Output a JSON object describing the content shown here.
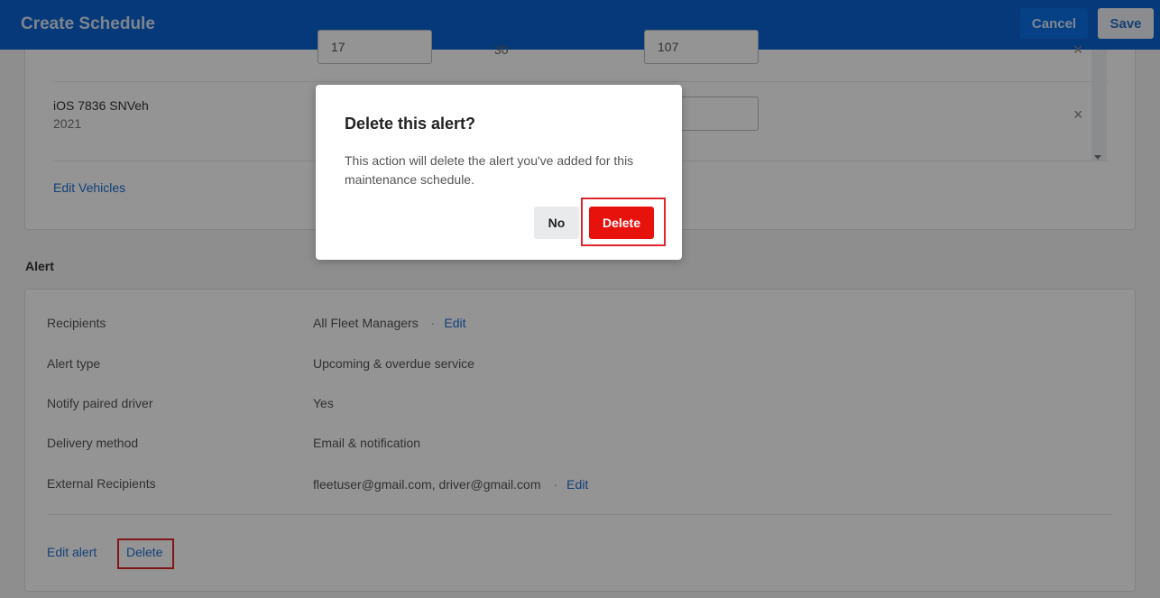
{
  "header": {
    "title": "Create Schedule",
    "cancel_label": "Cancel",
    "save_label": "Save"
  },
  "vehicles": {
    "partial_row_values": [
      "17",
      "30",
      "107"
    ],
    "rows": [
      {
        "name": "iOS 7836 SNVeh",
        "year": "2021"
      }
    ],
    "edit_label": "Edit Vehicles"
  },
  "alert": {
    "heading": "Alert",
    "rows": [
      {
        "label": "Recipients",
        "value": "All Fleet Managers",
        "edit": "Edit"
      },
      {
        "label": "Alert type",
        "value": "Upcoming & overdue service"
      },
      {
        "label": "Notify paired driver",
        "value": "Yes"
      },
      {
        "label": "Delivery method",
        "value": "Email & notification"
      },
      {
        "label": "External Recipients",
        "value": "fleetuser@gmail.com, driver@gmail.com",
        "edit": "Edit"
      }
    ],
    "separator": "·",
    "edit_alert_label": "Edit alert",
    "delete_label": "Delete"
  },
  "modal": {
    "title": "Delete this alert?",
    "body": "This action will delete the alert you've added for this maintenance schedule.",
    "no_label": "No",
    "delete_label": "Delete"
  },
  "icons": {
    "remove": "×"
  },
  "colors": {
    "header_bg": "#0a62d1",
    "link": "#1f6fd3",
    "danger": "#e8120c",
    "highlight_border": "#e0252d"
  }
}
